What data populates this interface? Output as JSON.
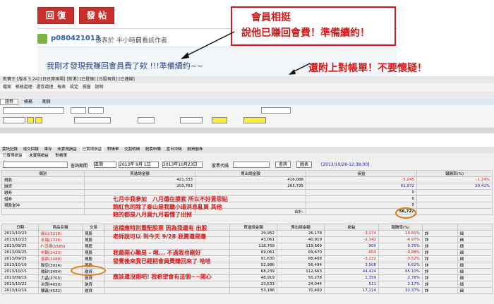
{
  "forum": {
    "reply_label": "回 復",
    "post_label": "發 帖",
    "username": "p080421013",
    "posted": "發表於 半小時前",
    "author_only": "只看該作者",
    "message": "我剛才發現我賺回會員費了欸 !!!準備續約~~"
  },
  "callouts": {
    "line1": "會員相挺",
    "line2": "說他已賺回會費！準備續約！",
    "line3": "還附上對帳單！不要懷疑！"
  },
  "app": {
    "title": "新寶王 [版本 5.24] [日日實現場] [新港] [已登錄] [台股現貨] [已連線]",
    "menu": [
      "檔案",
      "帳務處理",
      "證券處理",
      "報表",
      "設定",
      "視窗",
      "說明"
    ],
    "tabs1": [
      "證券",
      "帳務",
      "期貨"
    ],
    "tabs2": [
      "委託記錄",
      "成交回報",
      "庫存",
      "未實現損益",
      "已實現損益",
      "對帳單",
      "交割明細",
      "股票申購",
      "當日沖銷",
      "融資融券"
    ],
    "tabs3": [
      "已實現損益",
      "未實現損益",
      "對帳單"
    ],
    "query": {
      "label1": "查詢期間",
      "period": "區間",
      "date_from": "2013年 9月 1日",
      "date_to": "2013年10月23日",
      "code_label": "股票代碼",
      "query_btn": "查詢",
      "chart_btn": "圖表",
      "range_text": "[2013/10/28-12:38:00]"
    },
    "sum_headers": [
      "類別",
      "買進總金額",
      "賣出總金額",
      "損益",
      "報酬率(%)"
    ],
    "sum_rows": [
      [
        "現股",
        "421,333",
        "416,088",
        "-5,245",
        "-1.24%"
      ],
      [
        "融資",
        "203,763",
        "265,735",
        "61,972",
        "30.41%"
      ],
      [
        "融券",
        "",
        "",
        "0",
        ""
      ],
      [
        "借券",
        "",
        "",
        "0",
        ""
      ],
      [
        "現股當沖",
        "",
        "",
        "0",
        ""
      ]
    ],
    "total_label": "合計:",
    "total_value": "56,727",
    "detail_headers": [
      "日期",
      "商品名稱",
      "交易",
      "",
      "",
      "",
      "",
      "",
      "買進總金額",
      "賣出總金額",
      "損益",
      "報酬率(%)",
      "",
      ""
    ],
    "detail_rows": [
      [
        "2013/10/23",
        "晨山(3218)",
        "現股",
        "29,952",
        "26,178",
        "-3,174",
        "-10.81%"
      ],
      [
        "2013/10/23",
        "永福(1326)",
        "現股",
        "43,061",
        "40,919",
        "-2,142",
        "-4.97%"
      ],
      [
        "2013/09/25",
        "F-亞德(1589)",
        "現股",
        "118,769",
        "119,669",
        "900",
        "0.76%"
      ],
      [
        "2013/09/25",
        "中鋼(2423)",
        "現股",
        "69,061",
        "69,670",
        "-609",
        "-0.88%"
      ],
      [
        "2013/09/25",
        "富鼎(2488)",
        "現股",
        "91,630",
        "88,408",
        "-3,222",
        "-3.52%"
      ],
      [
        "2013/10/16",
        "聯亞(3024)",
        "現股",
        "52,986",
        "56,494",
        "3,508",
        "6.62%"
      ],
      [
        "2013/10/15",
        "微矽(3454)",
        "融資",
        "68,239",
        "112,663",
        "44,424",
        "65.10%"
      ],
      [
        "2013/09/16",
        "力晶(3705)",
        "融資",
        "48,919",
        "50,278",
        "1,359",
        "2.78%"
      ],
      [
        "2013/10/22",
        "台灣(4050)",
        "融資",
        "23,533",
        "24,044",
        "511",
        "2.17%"
      ],
      [
        "2013/10/16",
        "驊鑫(4532)",
        "融資",
        "53,186",
        "70,400",
        "17,214",
        "32.37%"
      ]
    ],
    "row_action1": "詳",
    "row_action2": "細"
  },
  "annotations": {
    "note1": "七月中我参加　八月還在摸索 所以不好意思贴",
    "note2": "飽紅色的除了泰山是我聽小道消息亂買 其他",
    "note3": "賠的都是八月買九月看懂了出掉",
    "note4": "這檔應特別重配股票 因為我還有 出股 ",
    "note5": "老師說可以 到今天 9/28 我賣還是賺",
    "note6": "我最開心難是 - 嗯... 不過我也剛好",
    "note7": "發覺後來我已經把會員費賺回來了 哈哈",
    "note8": "應該還沒錯吧! 我希望會有這個~~開心"
  }
}
